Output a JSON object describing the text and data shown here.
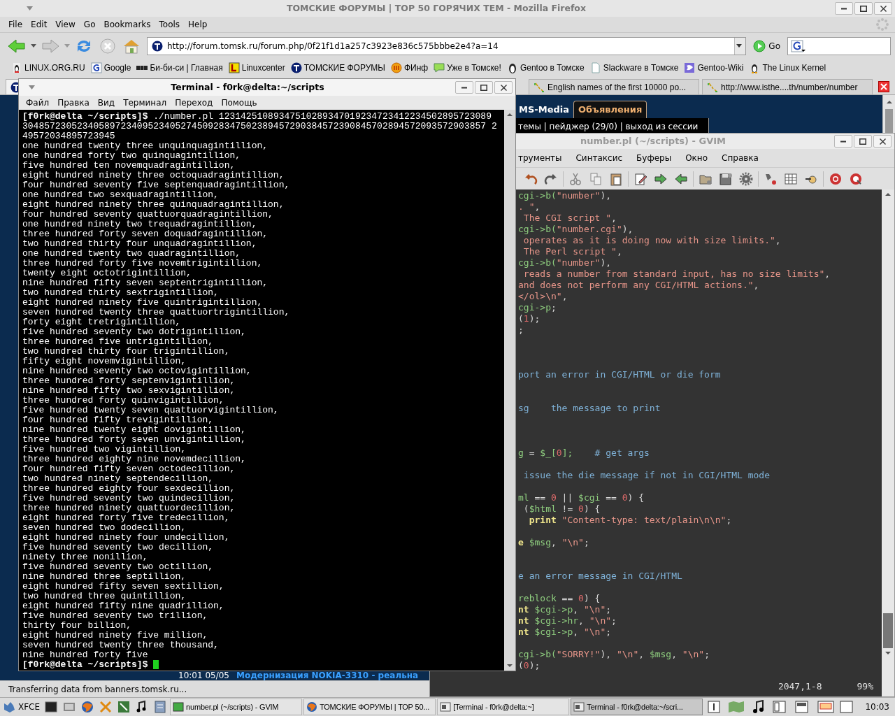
{
  "firefox": {
    "title": "ТОМСКИЕ ФОРУМЫ | ТОР 50 ГОРЯЧИХ ТЕМ - Mozilla Firefox",
    "menu": [
      "File",
      "Edit",
      "View",
      "Go",
      "Bookmarks",
      "Tools",
      "Help"
    ],
    "url": "http://forum.tomsk.ru/forum.php/0f21f1d1a257c3923e836c575bbbe2e4?a=14",
    "go_label": "Go",
    "bookmarks": [
      "LINUX.ORG.RU",
      "Google",
      "Би-би-си | Главная",
      "Linuxcenter",
      "ТОМСКИЕ ФОРУМЫ",
      "ФИнф",
      "Уже в Томске!",
      "Gentoo в Томске",
      "Slackware в Томске",
      "Gentoo-Wiki",
      "The Linux Kernel"
    ],
    "tabs": [
      {
        "label": "English names of the first 10000 po...",
        "selected": false
      },
      {
        "label": "http://www.isthe....th/number/number",
        "selected": false
      }
    ],
    "page": {
      "nav_tabs": [
        {
          "label": "MS-Media",
          "selected": false
        },
        {
          "label": "Объявления",
          "selected": true
        }
      ],
      "user_bar": "темы | пейджер (29/0) | выход из сессии",
      "news_time": "10:01 05/05",
      "news_title": "Модернизация NOKIA-3310 - реальна"
    },
    "status": "Transferring data from banners.tomsk.ru..."
  },
  "terminal": {
    "title": "Terminal - f0rk@delta:~/scripts",
    "menu": [
      "Файл",
      "Правка",
      "Вид",
      "Терминал",
      "Переход",
      "Помощь"
    ],
    "lines": [
      {
        "kind": "prompt",
        "prompt": "[f0rk@delta ~/scripts]$",
        "command": "./number.pl 12314251089347510289347019234723412234502895723089"
      },
      {
        "kind": "output",
        "text": "3048572305234058972340952340527450928347502389457290384572390845702894572093572903857 2"
      },
      {
        "kind": "output",
        "text": "49572034895723945"
      },
      {
        "kind": "output",
        "text": "one hundred twenty three unquinquagintillion,"
      },
      {
        "kind": "output",
        "text": "one hundred forty two quinquagintillion,"
      },
      {
        "kind": "output",
        "text": "five hundred ten novemquadragintillion,"
      },
      {
        "kind": "output",
        "text": "eight hundred ninety three octoquadragintillion,"
      },
      {
        "kind": "output",
        "text": "four hundred seventy five septenquadragintillion,"
      },
      {
        "kind": "output",
        "text": "one hundred two sexquadragintillion,"
      },
      {
        "kind": "output",
        "text": "eight hundred ninety three quinquadragintillion,"
      },
      {
        "kind": "output",
        "text": "four hundred seventy quattuorquadragintillion,"
      },
      {
        "kind": "output",
        "text": "one hundred ninety two trequadragintillion,"
      },
      {
        "kind": "output",
        "text": "three hundred forty seven doquadragintillion,"
      },
      {
        "kind": "output",
        "text": "two hundred thirty four unquadragintillion,"
      },
      {
        "kind": "output",
        "text": "one hundred twenty two quadragintillion,"
      },
      {
        "kind": "output",
        "text": "three hundred forty five novemtrigintillion,"
      },
      {
        "kind": "output",
        "text": "twenty eight octotrigintillion,"
      },
      {
        "kind": "output",
        "text": "nine hundred fifty seven septentrigintillion,"
      },
      {
        "kind": "output",
        "text": "two hundred thirty sextrigintillion,"
      },
      {
        "kind": "output",
        "text": "eight hundred ninety five quintrigintillion,"
      },
      {
        "kind": "output",
        "text": "seven hundred twenty three quattuortrigintillion,"
      },
      {
        "kind": "output",
        "text": "forty eight tretrigintillion,"
      },
      {
        "kind": "output",
        "text": "five hundred seventy two dotrigintillion,"
      },
      {
        "kind": "output",
        "text": "three hundred five untrigintillion,"
      },
      {
        "kind": "output",
        "text": "two hundred thirty four trigintillion,"
      },
      {
        "kind": "output",
        "text": "fifty eight novemvigintillion,"
      },
      {
        "kind": "output",
        "text": "nine hundred seventy two octovigintillion,"
      },
      {
        "kind": "output",
        "text": "three hundred forty septenvigintillion,"
      },
      {
        "kind": "output",
        "text": "nine hundred fifty two sexvigintillion,"
      },
      {
        "kind": "output",
        "text": "three hundred forty quinvigintillion,"
      },
      {
        "kind": "output",
        "text": "five hundred twenty seven quattuorvigintillion,"
      },
      {
        "kind": "output",
        "text": "four hundred fifty trevigintillion,"
      },
      {
        "kind": "output",
        "text": "nine hundred twenty eight dovigintillion,"
      },
      {
        "kind": "output",
        "text": "three hundred forty seven unvigintillion,"
      },
      {
        "kind": "output",
        "text": "five hundred two vigintillion,"
      },
      {
        "kind": "output",
        "text": "three hundred eighty nine novemdecillion,"
      },
      {
        "kind": "output",
        "text": "four hundred fifty seven octodecillion,"
      },
      {
        "kind": "output",
        "text": "two hundred ninety septendecillion,"
      },
      {
        "kind": "output",
        "text": "three hundred eighty four sexdecillion,"
      },
      {
        "kind": "output",
        "text": "five hundred seventy two quindecillion,"
      },
      {
        "kind": "output",
        "text": "three hundred ninety quattuordecillion,"
      },
      {
        "kind": "output",
        "text": "eight hundred forty five tredecillion,"
      },
      {
        "kind": "output",
        "text": "seven hundred two dodecillion,"
      },
      {
        "kind": "output",
        "text": "eight hundred ninety four undecillion,"
      },
      {
        "kind": "output",
        "text": "five hundred seventy two decillion,"
      },
      {
        "kind": "output",
        "text": "ninety three nonillion,"
      },
      {
        "kind": "output",
        "text": "five hundred seventy two octillion,"
      },
      {
        "kind": "output",
        "text": "nine hundred three septillion,"
      },
      {
        "kind": "output",
        "text": "eight hundred fifty seven sextillion,"
      },
      {
        "kind": "output",
        "text": "two hundred three quintillion,"
      },
      {
        "kind": "output",
        "text": "eight hundred fifty nine quadrillion,"
      },
      {
        "kind": "output",
        "text": "five hundred seventy two trillion,"
      },
      {
        "kind": "output",
        "text": "thirty four billion,"
      },
      {
        "kind": "output",
        "text": "eight hundred ninety five million,"
      },
      {
        "kind": "output",
        "text": "seven hundred twenty three thousand,"
      },
      {
        "kind": "output",
        "text": "nine hundred forty five"
      },
      {
        "kind": "prompt",
        "prompt": "[f0rk@delta ~/scripts]$",
        "cursor": true
      }
    ]
  },
  "gvim": {
    "title": "number.pl (~/scripts) - GVIM",
    "menu": [
      "трументы",
      "Синтаксис",
      "Буферы",
      "Окно",
      "Справка"
    ],
    "lines": [
      {
        "kind": "code",
        "segments": [
          {
            "kind": "var",
            "text": "cgi->b("
          },
          {
            "kind": "string",
            "text": "\"number\""
          },
          {
            "kind": "plain",
            "text": "),"
          }
        ]
      },
      {
        "kind": "code",
        "segments": [
          {
            "kind": "string",
            "text": ". \""
          },
          {
            "kind": "plain",
            "text": ","
          }
        ]
      },
      {
        "kind": "code",
        "segments": [
          {
            "kind": "string",
            "text": " The CGI script \""
          },
          {
            "kind": "plain",
            "text": ","
          }
        ]
      },
      {
        "kind": "code",
        "segments": [
          {
            "kind": "var",
            "text": "cgi->b("
          },
          {
            "kind": "string",
            "text": "\"number.cgi\""
          },
          {
            "kind": "plain",
            "text": "),"
          }
        ]
      },
      {
        "kind": "code",
        "segments": [
          {
            "kind": "string",
            "text": " operates as it is doing now with size limits.\""
          },
          {
            "kind": "plain",
            "text": ","
          }
        ]
      },
      {
        "kind": "code",
        "segments": [
          {
            "kind": "string",
            "text": " The Perl script \""
          },
          {
            "kind": "plain",
            "text": ","
          }
        ]
      },
      {
        "kind": "code",
        "segments": [
          {
            "kind": "var",
            "text": "cgi->b("
          },
          {
            "kind": "string",
            "text": "\"number\""
          },
          {
            "kind": "plain",
            "text": "),"
          }
        ]
      },
      {
        "kind": "code",
        "segments": [
          {
            "kind": "string",
            "text": " reads a number from standard input, has no size limits\""
          },
          {
            "kind": "plain",
            "text": ","
          }
        ]
      },
      {
        "kind": "code",
        "segments": [
          {
            "kind": "string",
            "text": "and does not perform any CGI/HTML actions.\""
          },
          {
            "kind": "plain",
            "text": ","
          }
        ]
      },
      {
        "kind": "code",
        "segments": [
          {
            "kind": "string",
            "text": "</ol>\\n\""
          },
          {
            "kind": "plain",
            "text": ","
          }
        ]
      },
      {
        "kind": "code",
        "segments": [
          {
            "kind": "var",
            "text": "cgi->p"
          },
          {
            "kind": "plain",
            "text": ";"
          }
        ]
      },
      {
        "kind": "code",
        "segments": [
          {
            "kind": "plain",
            "text": "("
          },
          {
            "kind": "number",
            "text": "1"
          },
          {
            "kind": "plain",
            "text": ");"
          }
        ]
      },
      {
        "kind": "code",
        "segments": [
          {
            "kind": "plain",
            "text": ";"
          }
        ]
      },
      {
        "kind": "blank"
      },
      {
        "kind": "blank"
      },
      {
        "kind": "blank"
      },
      {
        "kind": "code",
        "segments": [
          {
            "kind": "comment",
            "text": "port an error in CGI/HTML or die form"
          }
        ]
      },
      {
        "kind": "blank"
      },
      {
        "kind": "blank"
      },
      {
        "kind": "code",
        "segments": [
          {
            "kind": "comment",
            "text": "sg    the message to print"
          }
        ]
      },
      {
        "kind": "blank"
      },
      {
        "kind": "blank"
      },
      {
        "kind": "blank"
      },
      {
        "kind": "code",
        "segments": [
          {
            "kind": "var",
            "text": "g"
          },
          {
            "kind": "plain",
            "text": " = "
          },
          {
            "kind": "var",
            "text": "$_["
          },
          {
            "kind": "number",
            "text": "0"
          },
          {
            "kind": "var",
            "text": "];"
          },
          {
            "kind": "comment",
            "text": "    # get args"
          }
        ]
      },
      {
        "kind": "blank"
      },
      {
        "kind": "code",
        "segments": [
          {
            "kind": "comment",
            "text": " issue the die message if not in CGI/HTML mode"
          }
        ]
      },
      {
        "kind": "blank"
      },
      {
        "kind": "code",
        "segments": [
          {
            "kind": "var",
            "text": "ml"
          },
          {
            "kind": "plain",
            "text": " == "
          },
          {
            "kind": "number",
            "text": "0"
          },
          {
            "kind": "plain",
            "text": " || "
          },
          {
            "kind": "var",
            "text": "$cgi"
          },
          {
            "kind": "plain",
            "text": " == "
          },
          {
            "kind": "number",
            "text": "0"
          },
          {
            "kind": "plain",
            "text": ") {"
          }
        ]
      },
      {
        "kind": "code",
        "segments": [
          {
            "kind": "plain",
            "text": " ("
          },
          {
            "kind": "var",
            "text": "$html"
          },
          {
            "kind": "plain",
            "text": " != "
          },
          {
            "kind": "number",
            "text": "0"
          },
          {
            "kind": "plain",
            "text": ") {"
          }
        ]
      },
      {
        "kind": "code",
        "segments": [
          {
            "kind": "keyword",
            "text": "  print"
          },
          {
            "kind": "string",
            "text": " \"Content-type: text/plain\\n\\n\""
          },
          {
            "kind": "plain",
            "text": ";"
          }
        ]
      },
      {
        "kind": "blank"
      },
      {
        "kind": "code",
        "segments": [
          {
            "kind": "keyword",
            "text": "e"
          },
          {
            "kind": "var",
            "text": " $msg"
          },
          {
            "kind": "plain",
            "text": ", "
          },
          {
            "kind": "string",
            "text": "\"\\n\""
          },
          {
            "kind": "plain",
            "text": ";"
          }
        ]
      },
      {
        "kind": "blank"
      },
      {
        "kind": "blank"
      },
      {
        "kind": "code",
        "segments": [
          {
            "kind": "comment",
            "text": "e an error message in CGI/HTML"
          }
        ]
      },
      {
        "kind": "blank"
      },
      {
        "kind": "code",
        "segments": [
          {
            "kind": "var",
            "text": "reblock"
          },
          {
            "kind": "plain",
            "text": " == "
          },
          {
            "kind": "number",
            "text": "0"
          },
          {
            "kind": "plain",
            "text": ") {"
          }
        ]
      },
      {
        "kind": "code",
        "segments": [
          {
            "kind": "keyword",
            "text": "nt"
          },
          {
            "kind": "var",
            "text": " $cgi->p"
          },
          {
            "kind": "plain",
            "text": ", "
          },
          {
            "kind": "string",
            "text": "\"\\n\""
          },
          {
            "kind": "plain",
            "text": ";"
          }
        ]
      },
      {
        "kind": "code",
        "segments": [
          {
            "kind": "keyword",
            "text": "nt"
          },
          {
            "kind": "var",
            "text": " $cgi->hr"
          },
          {
            "kind": "plain",
            "text": ", "
          },
          {
            "kind": "string",
            "text": "\"\\n\""
          },
          {
            "kind": "plain",
            "text": ";"
          }
        ]
      },
      {
        "kind": "code",
        "segments": [
          {
            "kind": "keyword",
            "text": "nt"
          },
          {
            "kind": "var",
            "text": " $cgi->p"
          },
          {
            "kind": "plain",
            "text": ", "
          },
          {
            "kind": "string",
            "text": "\"\\n\""
          },
          {
            "kind": "plain",
            "text": ";"
          }
        ]
      },
      {
        "kind": "blank"
      },
      {
        "kind": "code",
        "segments": [
          {
            "kind": "var",
            "text": "cgi->b("
          },
          {
            "kind": "string",
            "text": "\"SORRY!\""
          },
          {
            "kind": "plain",
            "text": "), "
          },
          {
            "kind": "string",
            "text": "\"\\n\""
          },
          {
            "kind": "plain",
            "text": ", "
          },
          {
            "kind": "var",
            "text": "$msg"
          },
          {
            "kind": "plain",
            "text": ", "
          },
          {
            "kind": "string",
            "text": "\"\\n\""
          },
          {
            "kind": "plain",
            "text": ";"
          }
        ]
      },
      {
        "kind": "code",
        "segments": [
          {
            "kind": "plain",
            "text": "("
          },
          {
            "kind": "number",
            "text": "0"
          },
          {
            "kind": "plain",
            "text": ");"
          }
        ]
      }
    ],
    "position": "2047,1-8",
    "percent": "99%"
  },
  "taskbar": {
    "menu_label": "XFCE",
    "tasks": [
      {
        "label": "number.pl (~/scripts) - GVIM",
        "selected": false
      },
      {
        "label": "ТОМСКИЕ ФОРУМЫ | ТОР 50...",
        "selected": false
      },
      {
        "label": "[Terminal - f0rk@delta:~]",
        "selected": false
      },
      {
        "label": "Terminal - f0rk@delta:~/scri...",
        "selected": true
      }
    ],
    "clock": "10:03"
  }
}
